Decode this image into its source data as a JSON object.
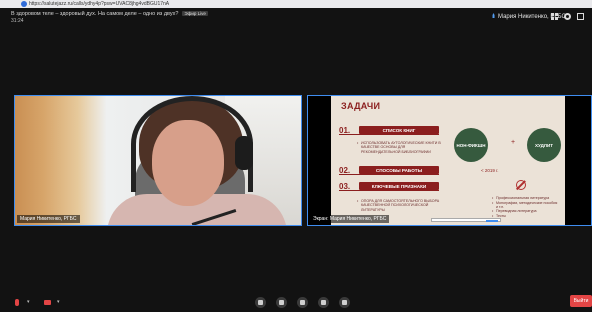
{
  "browser": {
    "url": "https://salutejazz.ru/calls/ydhy4p?psw=UVAC8jhg4vdBGU17nA"
  },
  "meeting": {
    "title": "В здоровом теле – здоровый дух. На самом деле – одно из двух?",
    "live_badge": "Эфир Live",
    "time": "31:24",
    "active_speaker": "Мария Никитенко, РГБС"
  },
  "tiles": {
    "camera_name": "Мария Никитенко, РГБС",
    "screen_name": "Экран: Мария Никитенко, РГБС"
  },
  "slide": {
    "title": "ЗАДАЧИ",
    "rows": [
      {
        "num": "01.",
        "label": "СПИСОК КНИГ",
        "bullet": "ИСПОЛЬЗОВАТЬ АУТОЛОГИЧЕСКИЕ КНИГИ В КАЧЕСТВЕ ОСНОВЫ ДЛЯ РЕКОМЕНДАТЕЛЬНОЙ БИБЛИОГРАФИИ"
      },
      {
        "num": "02.",
        "label": "СПОСОБЫ РАБОТЫ",
        "bullet": ""
      },
      {
        "num": "03.",
        "label": "КЛЮЧЕВЫЕ ПРИЗНАКИ",
        "bullet": "ОПОРА ДЛЯ САМОСТОЯТЕЛЬНОГО ВЫБОРА КАЧЕСТВЕННОЙ ПСИХОЛОГИЧЕСКОЙ ЛИТЕРАТУРЫ"
      }
    ],
    "circle_left": "НОН-ФИКШН",
    "circle_right": "ХУДЛИТ",
    "plus": "+",
    "year": "< 2019 г.",
    "right_bullets": [
      "Профессиональная литература",
      "Монографии, методические пособия и т.п.",
      "Переводная литература",
      "Тесты"
    ]
  },
  "toolbar": {
    "leave_label": "Выйти"
  },
  "colors": {
    "accent": "#3f8df0",
    "danger": "#e34545",
    "slide_red": "#8b1e1e",
    "slide_green": "#365a3e"
  }
}
